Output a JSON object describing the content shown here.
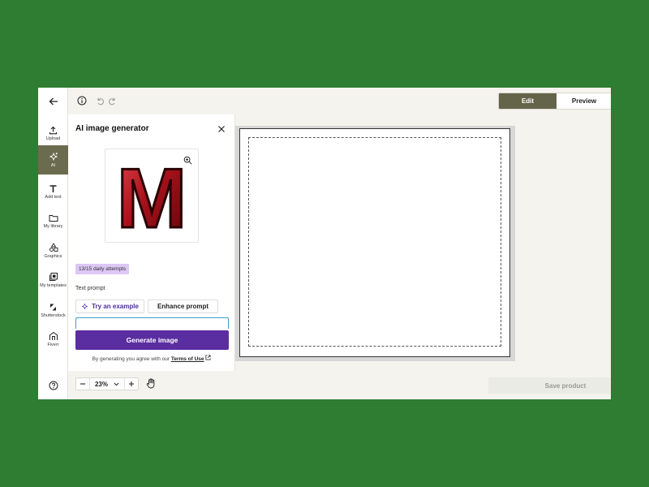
{
  "rail": {
    "items": [
      {
        "label": "Upload",
        "icon": "upload-icon"
      },
      {
        "label": "AI",
        "icon": "sparkle-icon"
      },
      {
        "label": "Add text",
        "icon": "text-icon"
      },
      {
        "label": "My library",
        "icon": "folder-icon"
      },
      {
        "label": "Graphics",
        "icon": "shapes-icon"
      },
      {
        "label": "My templates",
        "icon": "templates-icon"
      },
      {
        "label": "Shutterstock",
        "icon": "shutterstock-icon"
      },
      {
        "label": "Fiverr",
        "icon": "fiverr-icon"
      }
    ],
    "active": "AI"
  },
  "topbar": {
    "edit_label": "Edit",
    "preview_label": "Preview"
  },
  "panel": {
    "title": "AI image generator",
    "preview_letter": "M",
    "attempts_badge": "13/15 daily attempts",
    "prompt_label": "Text prompt",
    "try_example_label": "Try an example",
    "enhance_label": "Enhance prompt",
    "prompt_value": "",
    "generate_label": "Generate image",
    "terms_prefix": "By generating you agree with our",
    "terms_link": "Terms of Use"
  },
  "bottombar": {
    "zoom_value": "23%",
    "save_label": "Save product"
  },
  "colors": {
    "accent_olive": "#64644a",
    "generate_purple": "#5a2da0",
    "badge_lavender": "#dcc7f5",
    "letter_red": "#a8121c"
  }
}
